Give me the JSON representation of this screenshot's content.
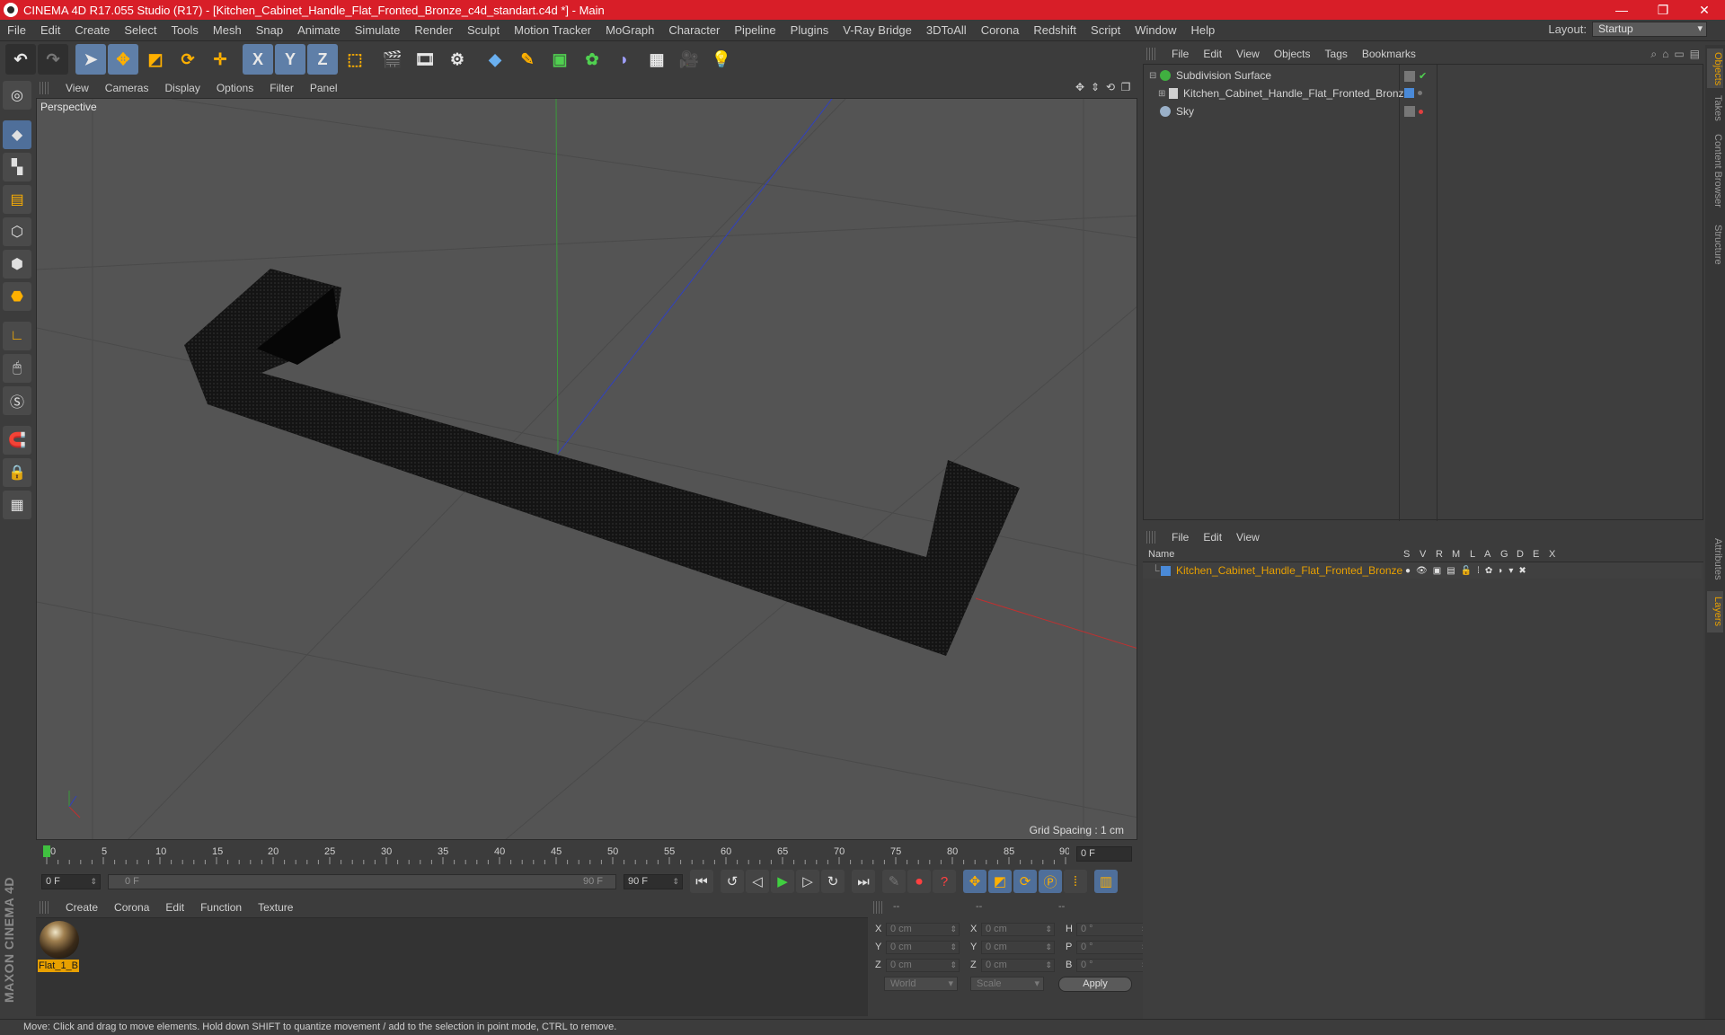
{
  "window": {
    "title": "CINEMA 4D R17.055 Studio (R17) - [Kitchen_Cabinet_Handle_Flat_Fronted_Bronze_c4d_standart.c4d *] - Main",
    "minimize": "—",
    "maximize": "❐",
    "close": "✕"
  },
  "menubar": [
    "File",
    "Edit",
    "Create",
    "Select",
    "Tools",
    "Mesh",
    "Snap",
    "Animate",
    "Simulate",
    "Render",
    "Sculpt",
    "Motion Tracker",
    "MoGraph",
    "Character",
    "Pipeline",
    "Plugins",
    "V-Ray Bridge",
    "3DToAll",
    "Corona",
    "Redshift",
    "Script",
    "Window",
    "Help"
  ],
  "layout": {
    "label": "Layout:",
    "value": "Startup"
  },
  "toolbar": {
    "x_label": "X",
    "y_label": "Y",
    "z_label": "Z"
  },
  "viewport": {
    "menu": [
      "View",
      "Cameras",
      "Display",
      "Options",
      "Filter",
      "Panel"
    ],
    "label": "Perspective",
    "grid_spacing": "Grid Spacing : 1 cm"
  },
  "timeline": {
    "ticks": [
      "0",
      "5",
      "10",
      "15",
      "20",
      "25",
      "30",
      "35",
      "40",
      "45",
      "50",
      "55",
      "60",
      "65",
      "70",
      "75",
      "80",
      "85",
      "90"
    ],
    "current_frame": "0 F"
  },
  "transport": {
    "start": "0 F",
    "range_start": "0 F",
    "range_end": "90 F",
    "end": "90 F"
  },
  "materials": {
    "menu": [
      "Create",
      "Corona",
      "Edit",
      "Function",
      "Texture"
    ],
    "items": [
      {
        "name": "Flat_1_B"
      }
    ]
  },
  "coordinates": {
    "headers": [
      "--",
      "--",
      "--"
    ],
    "rows": [
      {
        "a": "X",
        "v1": "0 cm",
        "b": "X",
        "v2": "0 cm",
        "c": "H",
        "v3": "0 °"
      },
      {
        "a": "Y",
        "v1": "0 cm",
        "b": "Y",
        "v2": "0 cm",
        "c": "P",
        "v3": "0 °"
      },
      {
        "a": "Z",
        "v1": "0 cm",
        "b": "Z",
        "v2": "0 cm",
        "c": "B",
        "v3": "0 °"
      }
    ],
    "mode": "World",
    "transform": "Scale",
    "apply": "Apply"
  },
  "status": "Move: Click and drag to move elements. Hold down SHIFT to quantize movement / add to the selection in point mode, CTRL to remove.",
  "objects": {
    "menu": [
      "File",
      "Edit",
      "View",
      "Objects",
      "Tags",
      "Bookmarks"
    ],
    "items": [
      {
        "name": "Subdivision Surface"
      },
      {
        "name": "Kitchen_Cabinet_Handle_Flat_Fronted_Bronze"
      },
      {
        "name": "Sky"
      }
    ]
  },
  "layers": {
    "menu": [
      "File",
      "Edit",
      "View"
    ],
    "columns": [
      "Name",
      "S",
      "V",
      "R",
      "M",
      "L",
      "A",
      "G",
      "D",
      "E",
      "X"
    ],
    "items": [
      {
        "name": "Kitchen_Cabinet_Handle_Flat_Fronted_Bronze"
      }
    ]
  },
  "edge_tabs": [
    "Objects",
    "Takes",
    "Content Browser",
    "Structure",
    "Attributes",
    "Layers"
  ],
  "logo": "MAXON CINEMA 4D",
  "colors": {
    "title_bar": "#d81e28",
    "accent": "#e8a000",
    "selection_blue": "#5f7fa8"
  }
}
